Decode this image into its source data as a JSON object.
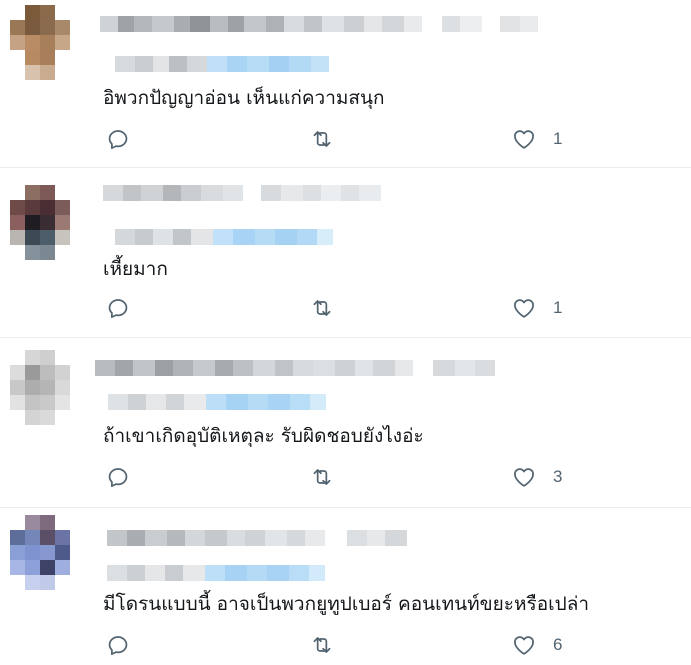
{
  "replies": [
    {
      "text": "อิพวกปัญญาอ่อน เห็นแก่ความสนุก",
      "likes": "1"
    },
    {
      "text": "เหี้ยมาก",
      "likes": "1"
    },
    {
      "text": "ถ้าเขาเกิดอุบัติเหตุละ รับผิดชอบยังไงอ่ะ",
      "likes": "3"
    },
    {
      "text": "มีโดรนแบบนี้ อาจเป็นพวกยูทูปเบอร์ คอนเทนท์ขยะหรือเปล่า",
      "likes": "6"
    }
  ],
  "icons": {
    "reply": "reply-icon",
    "retweet": "retweet-icon",
    "like": "like-icon"
  },
  "colors": {
    "icon": "#536471",
    "text": "#14171a",
    "divider": "#e6ecf0",
    "redacted_link": "#9fd1f5"
  }
}
